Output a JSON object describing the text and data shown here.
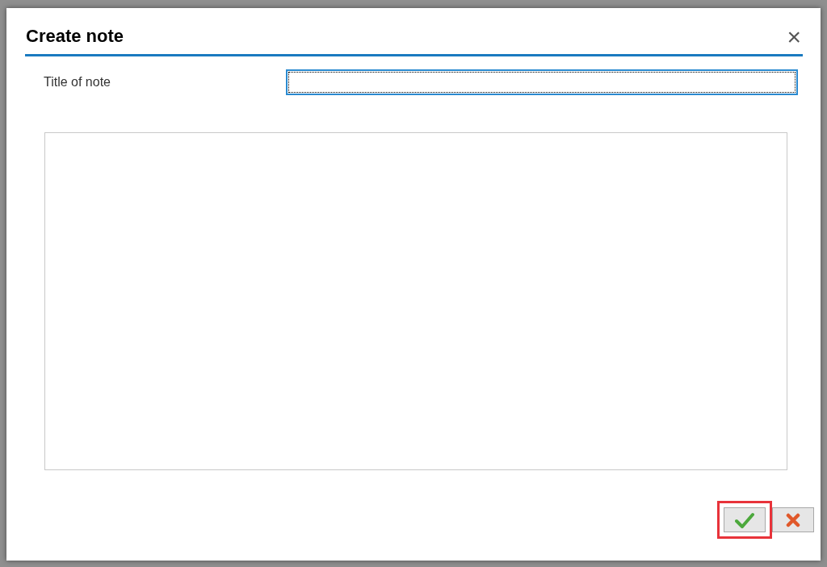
{
  "dialog": {
    "title": "Create note",
    "close_symbol": "×"
  },
  "title_field": {
    "label": "Title of note",
    "focused": true
  },
  "note_body": {
    "focused": false
  },
  "buttons": [
    {
      "kind": "confirm",
      "highlighted": true
    },
    {
      "kind": "cancel",
      "highlighted": false
    }
  ]
}
